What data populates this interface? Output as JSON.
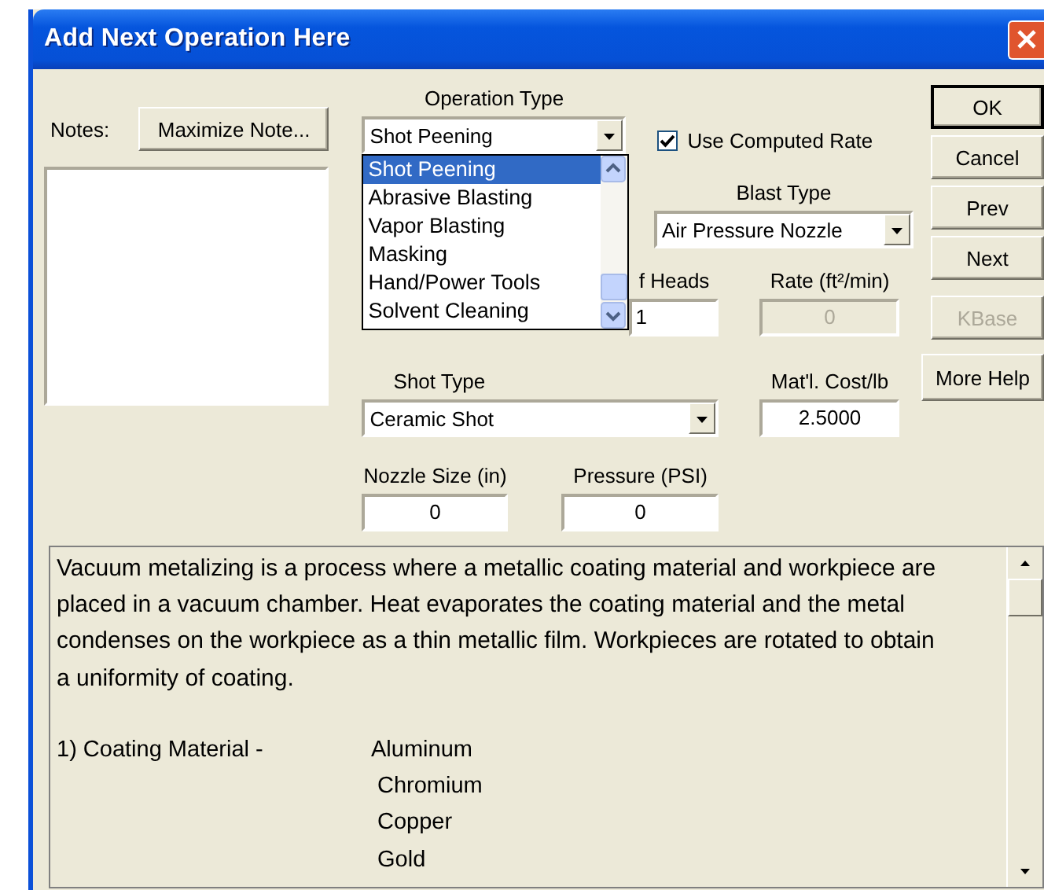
{
  "window": {
    "title": "Add Next Operation Here"
  },
  "notes": {
    "label": "Notes:",
    "button": "Maximize Note..."
  },
  "operation_type": {
    "label": "Operation Type",
    "value": "Shot Peening",
    "expanded": true,
    "options": [
      {
        "label": "Shot Peening",
        "selected": true
      },
      {
        "label": "Abrasive Blasting",
        "selected": false
      },
      {
        "label": "Vapor Blasting",
        "selected": false
      },
      {
        "label": "Masking",
        "selected": false
      },
      {
        "label": "Hand/Power Tools",
        "selected": false
      },
      {
        "label": "Solvent Cleaning",
        "selected": false
      }
    ]
  },
  "use_computed_rate": {
    "label": "Use Computed Rate",
    "checked": true
  },
  "blast_type": {
    "label": "Blast Type",
    "value": "Air Pressure Nozzle"
  },
  "heads": {
    "label": "f Heads",
    "value": "1"
  },
  "rate": {
    "label": "Rate (ft²/min)",
    "value": "0",
    "disabled": true
  },
  "shot_type": {
    "label": "Shot Type",
    "value": "Ceramic Shot"
  },
  "material_cost": {
    "label": "Mat'l. Cost/lb",
    "value": "2.5000"
  },
  "nozzle_size": {
    "label": "Nozzle Size (in)",
    "value": "0"
  },
  "pressure": {
    "label": "Pressure (PSI)",
    "value": "0"
  },
  "buttons": [
    {
      "label": "OK",
      "disabled": false
    },
    {
      "label": "Cancel",
      "disabled": false
    },
    {
      "label": "Prev",
      "disabled": false
    },
    {
      "label": "Next",
      "disabled": false
    },
    {
      "label": "KBase",
      "disabled": true
    }
  ],
  "help_button": {
    "label": "More Help"
  },
  "description": {
    "text": "Vacuum metalizing is a process where a metallic coating material and workpiece are placed in a vacuum chamber. Heat evaporates the coating material and the metal condenses on the workpiece as a thin metallic film. Workpieces are rotated to obtain a uniformity of coating.",
    "coating": {
      "label": "1) Coating Material -",
      "values": [
        "Aluminum",
        "Chromium",
        "Copper",
        "Gold"
      ]
    }
  }
}
